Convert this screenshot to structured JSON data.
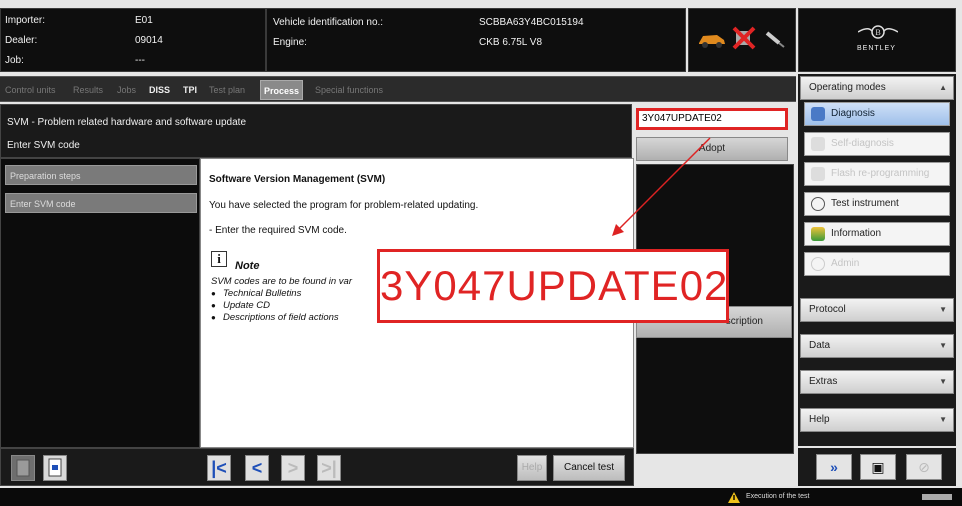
{
  "header": {
    "importer_label": "Importer:",
    "importer_value": "E01",
    "dealer_label": "Dealer:",
    "dealer_value": "09014",
    "job_label": "Job:",
    "job_value": "---",
    "vin_label": "Vehicle identification no.:",
    "vin_value": "SCBBA63Y4BC015194",
    "engine_label": "Engine:",
    "engine_value": "CKB 6.75L V8",
    "brand": "BENTLEY"
  },
  "tabs": [
    {
      "label": "Control units",
      "state": "faded"
    },
    {
      "label": "Results",
      "state": "faded"
    },
    {
      "label": "Jobs",
      "state": "faded"
    },
    {
      "label": "DISS",
      "state": "bright"
    },
    {
      "label": "TPI",
      "state": "bright"
    },
    {
      "label": "Test plan",
      "state": "faded"
    },
    {
      "label": "Process",
      "state": "active"
    },
    {
      "label": "Special functions",
      "state": "faded"
    }
  ],
  "title": {
    "line1": "SVM - Problem related hardware and software update",
    "line2": "Enter SVM code"
  },
  "svm_input_value": "3Y047UPDATE02",
  "adopt_label": "Adopt",
  "description_button_label": "scription",
  "steps": [
    {
      "label": "Preparation steps"
    },
    {
      "label": "Enter SVM code"
    }
  ],
  "content": {
    "heading": "Software Version Management (SVM)",
    "line1": "You have selected the program for problem-related updating.",
    "line2": "- Enter the required SVM code.",
    "note_icon": "i",
    "note_title": "Note",
    "note_intro": "SVM codes are to be found in var",
    "note_items": [
      "Technical Bulletins",
      "Update CD",
      "Descriptions of field actions"
    ]
  },
  "callout_text": "3Y047UPDATE02",
  "bottom": {
    "help_label": "Help",
    "cancel_label": "Cancel test"
  },
  "right_panel": {
    "operating_modes_label": "Operating modes",
    "modes": [
      {
        "label": "Diagnosis",
        "state": "selected",
        "icon": "diagnosis-icon"
      },
      {
        "label": "Self-diagnosis",
        "state": "disabled",
        "icon": "self-diagnosis-icon"
      },
      {
        "label": "Flash re-programming",
        "state": "disabled",
        "icon": "flash-icon"
      },
      {
        "label": "Test instrument",
        "state": "enabled",
        "icon": "test-instrument-icon"
      },
      {
        "label": "Information",
        "state": "enabled",
        "icon": "information-icon"
      },
      {
        "label": "Admin",
        "state": "disabled",
        "icon": "admin-icon"
      }
    ],
    "sections": [
      {
        "label": "Protocol"
      },
      {
        "label": "Data"
      },
      {
        "label": "Extras"
      },
      {
        "label": "Help"
      }
    ]
  },
  "status": {
    "message": "Execution of the test"
  },
  "colors": {
    "highlight_red": "#e02424",
    "nav_blue": "#1e4fb8",
    "selected_mode": "#9fc0ea"
  }
}
